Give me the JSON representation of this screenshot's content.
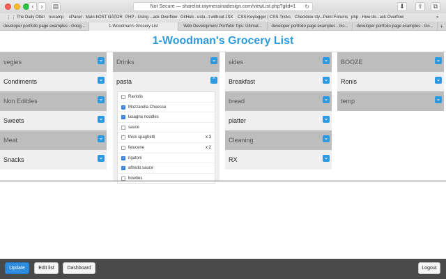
{
  "browser": {
    "back_glyph": "‹",
    "forward_glyph": "›",
    "sidebar_glyph": "▤",
    "url_text": "Not Secure — sharelist.raymessinadesign.com/viewList.php?glid=1",
    "reload_glyph": "↻",
    "download_glyph": "⬇",
    "share_glyph": "⇪",
    "tabs_glyph": "⧉",
    "bookmarks_more": "»",
    "bookmarks": [
      "The Daily Otter",
      "nucamp",
      "cPanel - Main-hOST GATOR",
      "PHP - Using ...ack Overflow",
      "GitHub - ustu...t without JSX",
      "CSS Keylogger | CSS-Tricks",
      "Checkbox sty...Point Forums",
      "php - How do...ack Overflow"
    ],
    "tabs": [
      "developer portfolio page examples - Goog...",
      "1-Woodman's Grocery List",
      "Web Development Portfolio Tips: Ultimat...",
      "developer portfolio page examples - Go...",
      "developer portfolio page examples - Go..."
    ],
    "new_tab_glyph": "+"
  },
  "page": {
    "title": "1-Woodman's Grocery List"
  },
  "icons": {
    "collapsed": "chevron-down-icon",
    "expanded": "chevron-up-icon",
    "collapsed_glyph": "⌄",
    "expanded_glyph": "⌃",
    "check_glyph": "✓"
  },
  "columns": [
    {
      "categories": [
        {
          "label": "vegies",
          "shade": "dark"
        },
        {
          "label": "Condiments",
          "shade": "light"
        },
        {
          "label": "Non Edibles",
          "shade": "dark"
        },
        {
          "label": "Sweets",
          "shade": "light"
        },
        {
          "label": "Meat",
          "shade": "dark"
        },
        {
          "label": "Snacks",
          "shade": "light"
        }
      ]
    },
    {
      "categories": [
        {
          "label": "Drinks",
          "shade": "dark"
        },
        {
          "label": "pasta",
          "shade": "light",
          "expanded": true
        }
      ]
    },
    {
      "categories": [
        {
          "label": "sides",
          "shade": "dark"
        },
        {
          "label": "Breakfast",
          "shade": "light"
        },
        {
          "label": "bread",
          "shade": "dark"
        },
        {
          "label": "platter",
          "shade": "light"
        },
        {
          "label": "Cleaning",
          "shade": "dark"
        },
        {
          "label": "RX",
          "shade": "light"
        }
      ]
    },
    {
      "categories": [
        {
          "label": "BOOZE",
          "shade": "dark"
        },
        {
          "label": "Ronis",
          "shade": "light"
        },
        {
          "label": "temp",
          "shade": "dark"
        }
      ]
    }
  ],
  "pasta_items": [
    {
      "name": "Raviolis",
      "checked": false,
      "qty": ""
    },
    {
      "name": "Mozzarella Cheesse",
      "checked": true,
      "qty": ""
    },
    {
      "name": "lasagna noodles",
      "checked": true,
      "qty": ""
    },
    {
      "name": "sauce",
      "checked": false,
      "qty": ""
    },
    {
      "name": "thick spaghetti",
      "checked": false,
      "qty": "x  3"
    },
    {
      "name": "fetucene",
      "checked": false,
      "qty": "x  2"
    },
    {
      "name": "rigatoni",
      "checked": true,
      "qty": ""
    },
    {
      "name": "alfredo sauce",
      "checked": true,
      "qty": ""
    },
    {
      "name": "bowties",
      "checked": false,
      "qty": ""
    }
  ],
  "footer": {
    "update": "Update",
    "edit_list": "Edit list",
    "dashboard": "Dashboard",
    "logout": "Logout"
  },
  "colors": {
    "accent": "#2d9bd9",
    "button_primary": "#2f8de0",
    "category_dark": "#bdbdbd",
    "category_light": "#efefef",
    "footer_bg": "#4a4a4a"
  }
}
